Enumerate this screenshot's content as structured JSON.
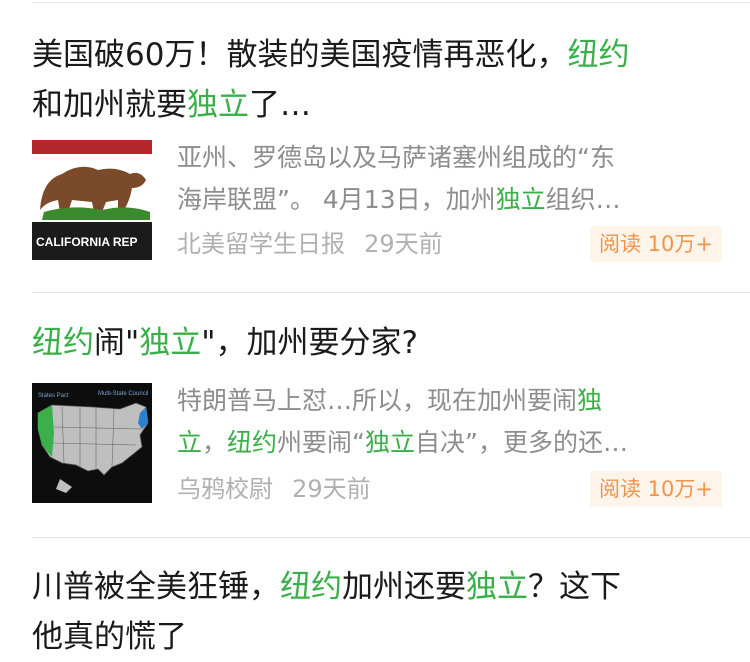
{
  "articles": [
    {
      "title_parts": [
        {
          "text": "美国破60万！散装的美国疫情再恶化，",
          "hl": false
        },
        {
          "text": "纽约",
          "hl": true
        }
      ],
      "title_line2_parts": [
        {
          "text": "和加州就要",
          "hl": false
        },
        {
          "text": "独立",
          "hl": true
        },
        {
          "text": "了…",
          "hl": false
        }
      ],
      "excerpt_line1_parts": [
        {
          "text": "亚州、罗德岛以及马萨诸塞州组成的“东",
          "hl": false
        }
      ],
      "excerpt_line2_parts": [
        {
          "text": "海岸联盟”。 4月13日，加州",
          "hl": false
        },
        {
          "text": "独立",
          "hl": true
        },
        {
          "text": "组织…",
          "hl": false
        }
      ],
      "source": "北美留学生日报",
      "time": "29天前",
      "badge": "阅读 10万+",
      "thumb_icon": "california-flag-bear-image",
      "thumb_text": "CALIFORNIA REP"
    },
    {
      "title_parts": [
        {
          "text": "纽约",
          "hl": true
        },
        {
          "text": "闹\"",
          "hl": false
        },
        {
          "text": "独立",
          "hl": true
        },
        {
          "text": "\"，加州要分家?",
          "hl": false
        }
      ],
      "excerpt_line1_parts": [
        {
          "text": "特朗普马上怼…所以，现在加州要闹",
          "hl": false
        },
        {
          "text": "独",
          "hl": true
        }
      ],
      "excerpt_line2_parts": [
        {
          "text": "立",
          "hl": true
        },
        {
          "text": "，",
          "hl": false
        },
        {
          "text": "纽约",
          "hl": true
        },
        {
          "text": "州要闹“",
          "hl": false
        },
        {
          "text": "独立",
          "hl": true
        },
        {
          "text": "自决”，更多的还…",
          "hl": false
        }
      ],
      "source": "乌鸦校尉",
      "time": "29天前",
      "badge": "阅读 10万+",
      "thumb_icon": "us-map-image",
      "thumb_label_left": "States Pact",
      "thumb_label_right": "Multi-State Council"
    },
    {
      "title_parts": [
        {
          "text": "川普被全美狂锤，",
          "hl": false
        },
        {
          "text": "纽约",
          "hl": true
        },
        {
          "text": "加州还要",
          "hl": false
        },
        {
          "text": "独立",
          "hl": true
        },
        {
          "text": "？这下",
          "hl": false
        }
      ],
      "title_line2_parts": [
        {
          "text": "他真的慌了",
          "hl": false
        }
      ]
    }
  ],
  "colors": {
    "highlight": "#3bb04a",
    "meta": "#b0b0b0",
    "excerpt": "#8d8d8d",
    "badge_bg": "#fff4ea",
    "badge_text": "#f0944a"
  }
}
